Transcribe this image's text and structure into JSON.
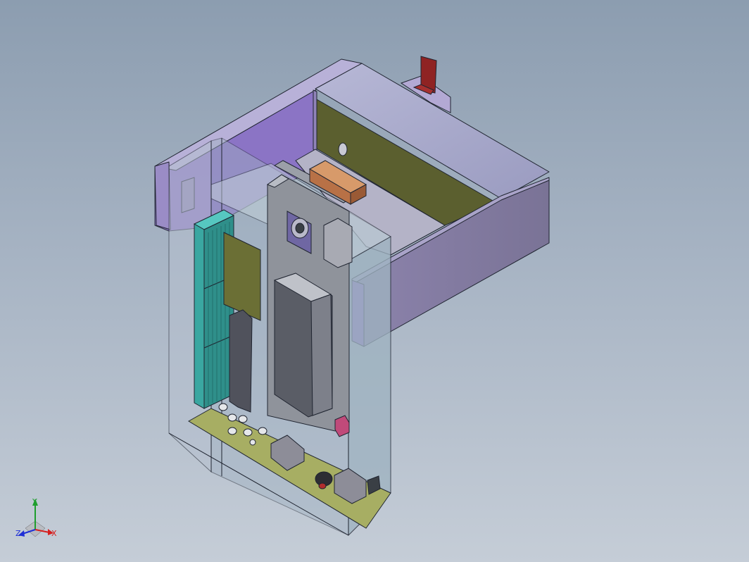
{
  "viewport": {
    "colors": {
      "bg_top": "#8c9db0",
      "bg_bottom": "#c5cdd7",
      "edge": "#1f2430",
      "accent_pcb": "#a7ae63",
      "heatsink": "#3aa7a1"
    }
  },
  "triad": {
    "x_label": "X",
    "y_label": "Y",
    "z_label": "Z",
    "colors": {
      "x": "#d62020",
      "y": "#1e9e2e",
      "z": "#1e2ed6"
    }
  }
}
